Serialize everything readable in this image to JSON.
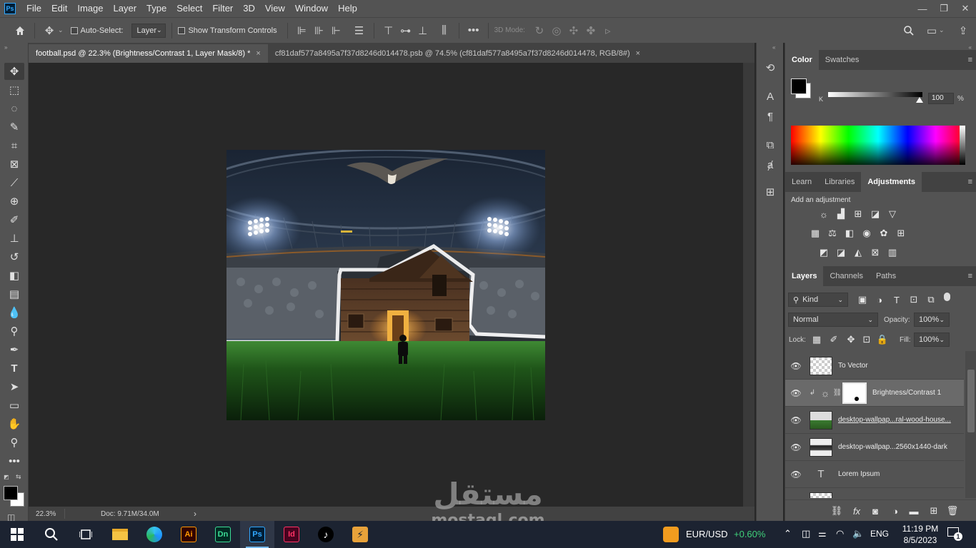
{
  "menubar": {
    "logo": "Ps",
    "items": [
      "File",
      "Edit",
      "Image",
      "Layer",
      "Type",
      "Select",
      "Filter",
      "3D",
      "View",
      "Window",
      "Help"
    ]
  },
  "options": {
    "auto_select_label": "Auto-Select:",
    "auto_select_target": "Layer",
    "show_transform_label": "Show Transform Controls",
    "mode_3d_label": "3D Mode:"
  },
  "tabs": [
    {
      "label": "football.psd @ 22.3% (Brightness/Contrast 1, Layer Mask/8) *",
      "close": "×"
    },
    {
      "label": "cf81daf577a8495a7f37d8246d014478.psb @ 74.5% (cf81daf577a8495a7f37d8246d014478, RGB/8#)",
      "close": "×"
    }
  ],
  "status": {
    "zoom": "22.3%",
    "doc": "Doc: 9.71M/34.0M",
    "arrow": "›"
  },
  "color_panel": {
    "tabs": [
      "Color",
      "Swatches"
    ],
    "channel_label": "K",
    "value": "100",
    "unit": "%"
  },
  "adjustments_panel": {
    "tabs": [
      "Learn",
      "Libraries",
      "Adjustments"
    ],
    "hint": "Add an adjustment"
  },
  "layers_panel": {
    "tabs": [
      "Layers",
      "Channels",
      "Paths"
    ],
    "filter_kind": "Kind",
    "blend_mode": "Normal",
    "opacity_label": "Opacity:",
    "opacity_value": "100%",
    "lock_label": "Lock:",
    "fill_label": "Fill:",
    "fill_value": "100%",
    "layers": [
      {
        "name": "To Vector"
      },
      {
        "name": "Brightness/Contrast 1"
      },
      {
        "name": "desktop-wallpap...ral-wood-house..."
      },
      {
        "name": "desktop-wallpap...2560x1440-dark"
      },
      {
        "name": "Lorem Ipsum",
        "type_glyph": "T"
      }
    ]
  },
  "taskbar": {
    "ticker_label": "EUR/USD",
    "ticker_change": "+0.60%",
    "language": "ENG",
    "time": "11:19 PM",
    "date": "8/5/2023",
    "notifications": "1",
    "apps": [
      {
        "name": "file-explorer",
        "label": ""
      },
      {
        "name": "edge",
        "label": ""
      },
      {
        "name": "illustrator",
        "label": "Ai",
        "color": "#ff9a00",
        "bg": "#330000"
      },
      {
        "name": "dimension",
        "label": "Dn",
        "color": "#3ddc97",
        "bg": "#002b22"
      },
      {
        "name": "photoshop",
        "label": "Ps",
        "color": "#31a8ff",
        "bg": "#001e36"
      },
      {
        "name": "indesign",
        "label": "Id",
        "color": "#ff3366",
        "bg": "#49021f"
      },
      {
        "name": "tiktok",
        "label": "♪"
      },
      {
        "name": "app-other",
        "label": "⚡"
      }
    ]
  },
  "watermark": {
    "arabic": "مستقل",
    "latin": "mostaql.com"
  }
}
